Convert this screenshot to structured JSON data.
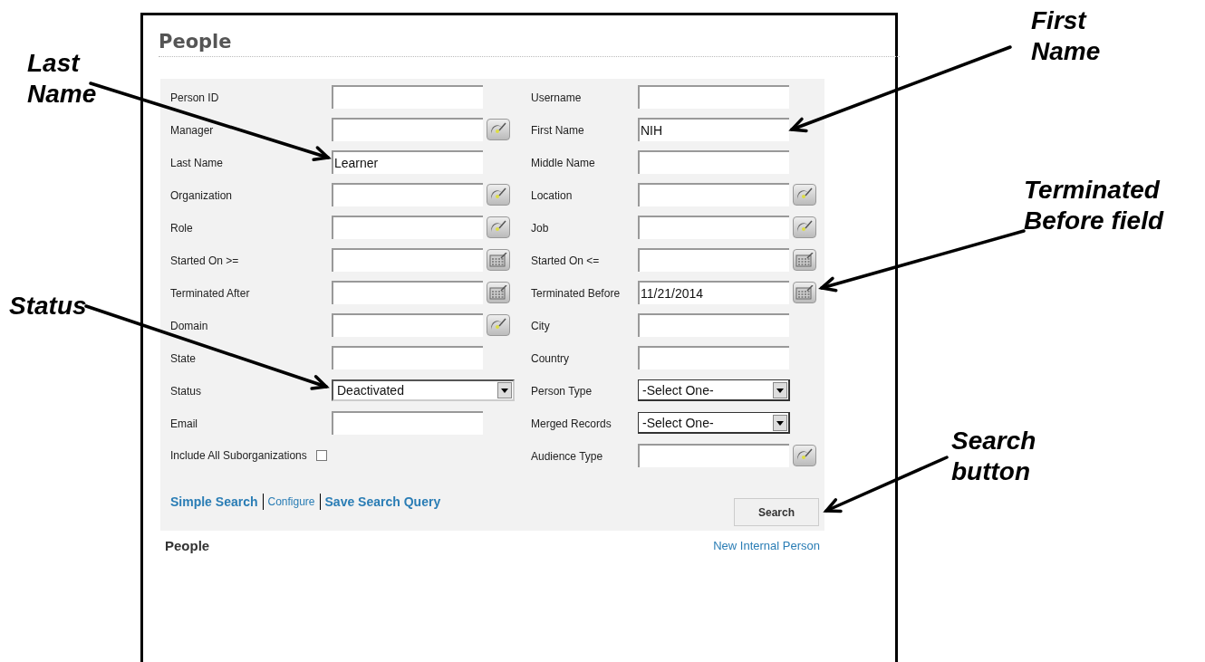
{
  "page": {
    "title": "People"
  },
  "search_form": {
    "rows": [
      {
        "left": {
          "label": "Person ID",
          "kind": "text"
        },
        "right": {
          "label": "Username",
          "kind": "text"
        }
      },
      {
        "left": {
          "label": "Manager",
          "kind": "lookup"
        },
        "right": {
          "label": "First Name",
          "kind": "text",
          "value": "NIH"
        }
      },
      {
        "left": {
          "label": "Last Name",
          "kind": "text",
          "value": "Learner"
        },
        "right": {
          "label": "Middle Name",
          "kind": "text"
        }
      },
      {
        "left": {
          "label": "Organization",
          "kind": "lookup"
        },
        "right": {
          "label": "Location",
          "kind": "lookup"
        }
      },
      {
        "left": {
          "label": "Role",
          "kind": "lookup"
        },
        "right": {
          "label": "Job",
          "kind": "lookup"
        }
      },
      {
        "left": {
          "label": "Started On >=",
          "kind": "date"
        },
        "right": {
          "label": "Started On <=",
          "kind": "date"
        }
      },
      {
        "left": {
          "label": "Terminated After",
          "kind": "date"
        },
        "right": {
          "label": "Terminated Before",
          "kind": "date",
          "value": "11/21/2014"
        }
      },
      {
        "left": {
          "label": "Domain",
          "kind": "lookup"
        },
        "right": {
          "label": "City",
          "kind": "text"
        }
      },
      {
        "left": {
          "label": "State",
          "kind": "text"
        },
        "right": {
          "label": "Country",
          "kind": "text"
        }
      },
      {
        "left": {
          "label": "Status",
          "kind": "select",
          "value": "Deactivated"
        },
        "right": {
          "label": "Person Type",
          "kind": "select",
          "value": "-Select One-"
        }
      },
      {
        "left": {
          "label": "Email",
          "kind": "text"
        },
        "right": {
          "label": "Merged Records",
          "kind": "select",
          "value": "-Select One-"
        }
      },
      {
        "left": {
          "label": "Include All Suborganizations",
          "kind": "checkbox",
          "checked": false
        },
        "right": {
          "label": "Audience Type",
          "kind": "lookup"
        }
      }
    ],
    "links": [
      "Simple Search",
      "Configure",
      "Save Search Query"
    ],
    "search_button": "Search"
  },
  "results": {
    "title": "People",
    "new_link": "New Internal Person"
  },
  "annotations": [
    {
      "text": "Last Name"
    },
    {
      "text": "First Name"
    },
    {
      "text": "Terminated Before field"
    },
    {
      "text": "Status"
    },
    {
      "text": "Search button"
    }
  ]
}
